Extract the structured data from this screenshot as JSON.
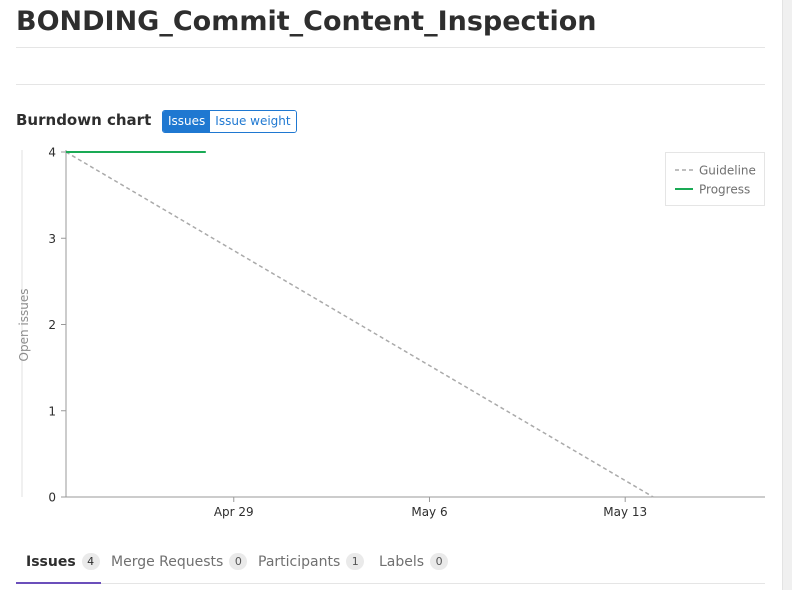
{
  "page": {
    "title": "BONDING_Commit_Content_Inspection"
  },
  "burndown": {
    "heading": "Burndown chart",
    "toggle": {
      "issues_label": "Issues",
      "issue_weight_label": "Issue weight",
      "selected": "Issues"
    }
  },
  "chart_data": {
    "type": "line",
    "ylabel": "Open issues",
    "xlabel": "",
    "ylim": [
      0,
      4
    ],
    "y_ticks": [
      "0",
      "1",
      "2",
      "3",
      "4"
    ],
    "x_range": [
      "2019-04-23",
      "2019-05-18"
    ],
    "x_ticks": [
      {
        "date": "2019-04-29",
        "label": "Apr 29"
      },
      {
        "date": "2019-05-06",
        "label": "May 6"
      },
      {
        "date": "2019-05-13",
        "label": "May 13"
      }
    ],
    "legend_position": "top-right",
    "series": [
      {
        "name": "Guideline",
        "style": "dashed",
        "color": "#aaaaaa",
        "points": [
          {
            "x": "2019-04-23",
            "y": 4
          },
          {
            "x": "2019-05-14",
            "y": 0
          }
        ]
      },
      {
        "name": "Progress",
        "style": "solid",
        "color": "#1aaa55",
        "points": [
          {
            "x": "2019-04-23",
            "y": 4
          },
          {
            "x": "2019-04-28",
            "y": 4
          }
        ]
      }
    ]
  },
  "tabs": [
    {
      "label": "Issues",
      "count": "4",
      "active": true
    },
    {
      "label": "Merge Requests",
      "count": "0",
      "active": false
    },
    {
      "label": "Participants",
      "count": "1",
      "active": false
    },
    {
      "label": "Labels",
      "count": "0",
      "active": false
    }
  ],
  "colors": {
    "accent": "#1f78d1",
    "active_tab_underline": "#6b4fbb",
    "progress": "#1aaa55",
    "guideline": "#aaaaaa"
  }
}
